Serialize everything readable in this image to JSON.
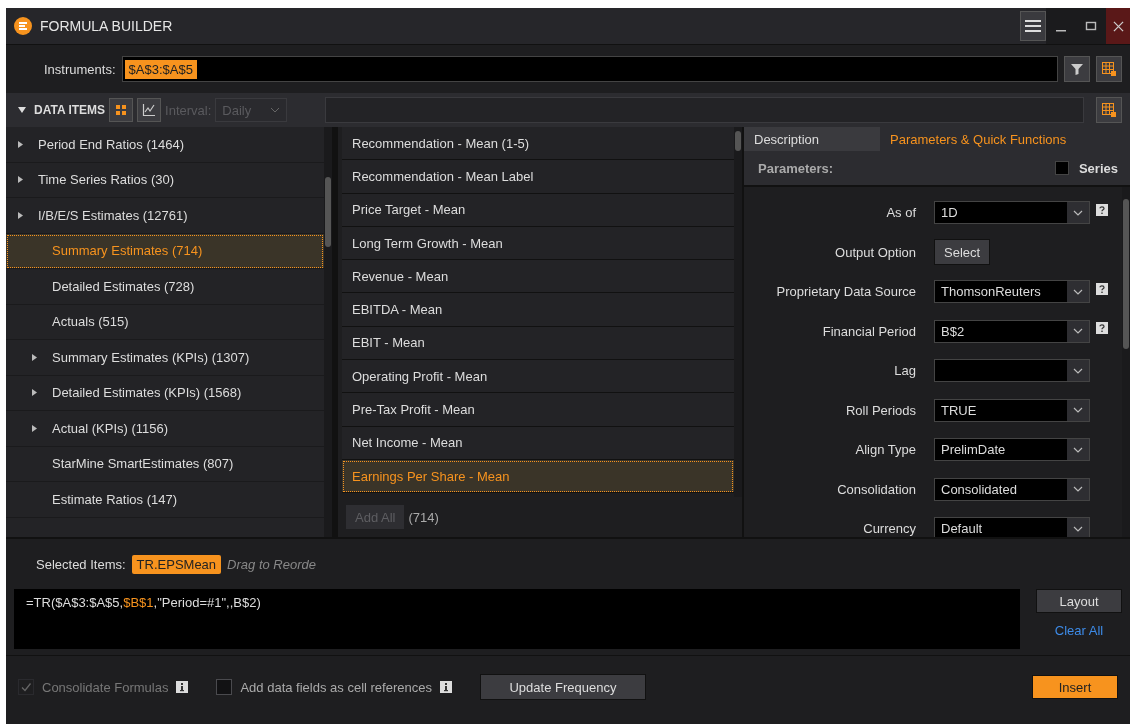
{
  "window": {
    "title": "FORMULA BUILDER"
  },
  "instruments": {
    "label": "Instruments:",
    "token": "$A$3:$A$5"
  },
  "data_items": {
    "label": "DATA ITEMS",
    "interval_label": "Interval:",
    "interval_value": "Daily",
    "interval_disabled": true
  },
  "tree": [
    {
      "label": "Period End Ratios (1464)",
      "kind": "group",
      "selected": false
    },
    {
      "label": "Time Series Ratios (30)",
      "kind": "group",
      "selected": false
    },
    {
      "label": "I/B/E/S Estimates (12761)",
      "kind": "group",
      "selected": false,
      "children": [
        {
          "label": "Summary Estimates (714)",
          "kind": "leaf",
          "selected": true
        },
        {
          "label": "Detailed Estimates (728)",
          "kind": "leaf",
          "selected": false
        },
        {
          "label": "Actuals (515)",
          "kind": "leaf",
          "selected": false
        },
        {
          "label": "Summary Estimates (KPIs) (1307)",
          "kind": "group",
          "selected": false
        },
        {
          "label": "Detailed Estimates (KPIs) (1568)",
          "kind": "group",
          "selected": false
        },
        {
          "label": "Actual (KPIs) (1156)",
          "kind": "group",
          "selected": false
        },
        {
          "label": "StarMine SmartEstimates (807)",
          "kind": "leaf",
          "selected": false
        },
        {
          "label": "Estimate Ratios (147)",
          "kind": "leaf",
          "selected": false
        }
      ]
    }
  ],
  "fields": [
    {
      "label": "Recommendation - Mean (1-5)",
      "selected": false
    },
    {
      "label": "Recommendation - Mean Label",
      "selected": false
    },
    {
      "label": "Price Target - Mean",
      "selected": false
    },
    {
      "label": "Long Term Growth - Mean",
      "selected": false
    },
    {
      "label": "Revenue - Mean",
      "selected": false
    },
    {
      "label": "EBITDA - Mean",
      "selected": false
    },
    {
      "label": "EBIT - Mean",
      "selected": false
    },
    {
      "label": "Operating Profit - Mean",
      "selected": false
    },
    {
      "label": "Pre-Tax Profit - Mean",
      "selected": false
    },
    {
      "label": "Net Income - Mean",
      "selected": false
    },
    {
      "label": "Earnings Per Share - Mean",
      "selected": true
    }
  ],
  "add_all": {
    "label": "Add All",
    "disabled": true,
    "count": "(714)"
  },
  "tabs": [
    {
      "label": "Description",
      "selected": false
    },
    {
      "label": "Parameters & Quick Functions",
      "selected": true
    }
  ],
  "parameters": {
    "title": "Parameters:",
    "series_label": "Series",
    "series_checked": false,
    "rows": [
      {
        "label": "As of",
        "kind": "dropdown",
        "value": "1D",
        "help": true
      },
      {
        "label": "Output Option",
        "kind": "button",
        "value": "Select",
        "help": false
      },
      {
        "label": "Proprietary Data Source",
        "kind": "dropdown",
        "value": "ThomsonReuters",
        "help": true
      },
      {
        "label": "Financial Period",
        "kind": "dropdown",
        "value": "B$2",
        "help": true
      },
      {
        "label": "Lag",
        "kind": "dropdown",
        "help": false
      },
      {
        "label": "Roll Periods",
        "kind": "dropdown",
        "value": "TRUE",
        "help": false
      },
      {
        "label": "Align Type",
        "kind": "dropdown",
        "value": "PrelimDate",
        "help": false
      },
      {
        "label": "Consolidation",
        "kind": "dropdown",
        "value": "Consolidated",
        "help": false
      },
      {
        "label": "Currency",
        "kind": "dropdown",
        "value": "Default",
        "help": false
      }
    ]
  },
  "selected_items": {
    "label": "Selected Items:",
    "token": "TR.EPSMean",
    "hint": "Drag to Reorde"
  },
  "formula": [
    {
      "text": "=TR($A$3:$A$5,",
      "highlight": false
    },
    {
      "text": "$B$1",
      "highlight": true
    },
    {
      "text": ",\"Period=#1\",,B$2)",
      "highlight": false
    }
  ],
  "layout_button": "Layout",
  "clear_all": "Clear All",
  "options": [
    {
      "label": "Consolidate Formulas",
      "checked": true,
      "disabled": true
    },
    {
      "label": "Add data fields as cell references",
      "checked": false,
      "disabled": false
    }
  ],
  "update_button": "Update Frequency",
  "insert_button": "Insert"
}
